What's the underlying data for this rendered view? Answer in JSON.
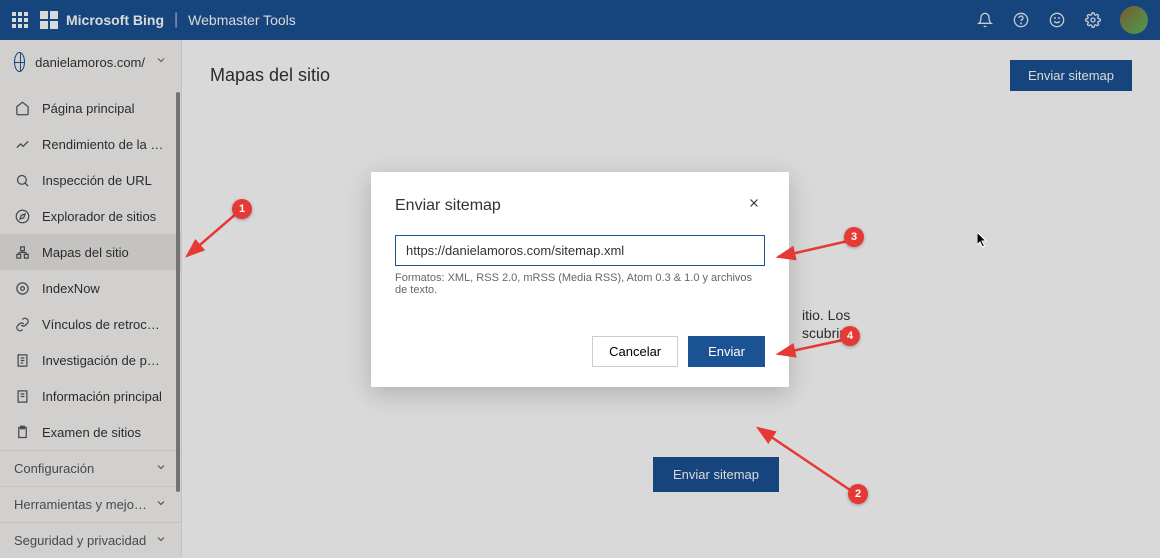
{
  "topbar": {
    "brand": "Microsoft Bing",
    "subtitle": "Webmaster Tools"
  },
  "sidebar": {
    "site": "danielamoros.com/",
    "items": [
      {
        "label": "Página principal",
        "icon": "home-icon"
      },
      {
        "label": "Rendimiento de la búsq…",
        "icon": "performance-icon"
      },
      {
        "label": "Inspección de URL",
        "icon": "search-icon"
      },
      {
        "label": "Explorador de sitios",
        "icon": "compass-icon"
      },
      {
        "label": "Mapas del sitio",
        "icon": "sitemap-icon",
        "active": true
      },
      {
        "label": "IndexNow",
        "icon": "gear-icon"
      },
      {
        "label": "Vínculos de retroceso",
        "icon": "link-icon"
      },
      {
        "label": "Investigación de palabra…",
        "icon": "document-icon"
      },
      {
        "label": "Información principal",
        "icon": "document-icon"
      },
      {
        "label": "Examen de sitios",
        "icon": "clipboard-icon"
      }
    ],
    "groups": [
      {
        "label": "Configuración"
      },
      {
        "label": "Herramientas y mejo…"
      },
      {
        "label": "Seguridad y privacidad"
      }
    ]
  },
  "main": {
    "title": "Mapas del sitio",
    "submit_button": "Enviar sitemap",
    "empty_text_1": "itio. Los",
    "empty_text_2": "scubrir",
    "cta_button": "Enviar sitemap"
  },
  "modal": {
    "title": "Enviar sitemap",
    "input_value": "https://danielamoros.com/sitemap.xml",
    "hint": "Formatos: XML, RSS 2.0, mRSS (Media RSS), Atom 0.3 & 1.0 y archivos de texto.",
    "cancel": "Cancelar",
    "submit": "Enviar"
  },
  "annotations": {
    "b1": "1",
    "b2": "2",
    "b3": "3",
    "b4": "4"
  }
}
